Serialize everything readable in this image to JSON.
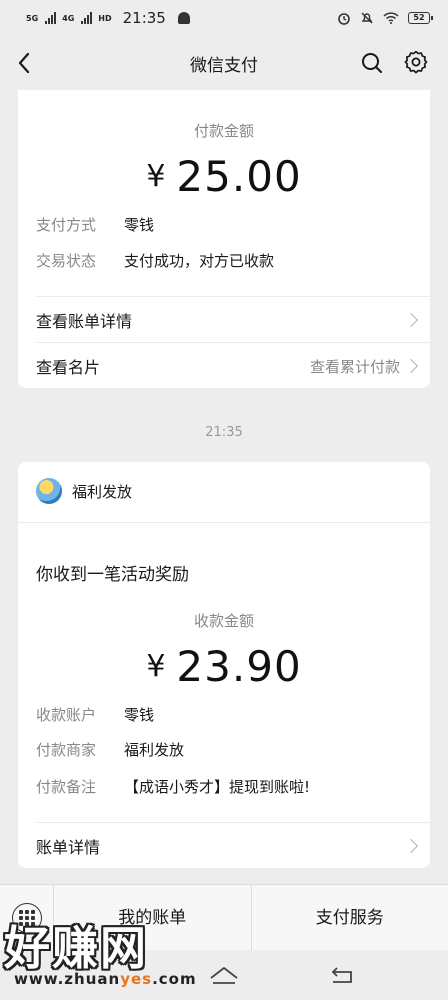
{
  "status_bar": {
    "sig1_label": "5G",
    "sig2_label": "4G",
    "hd_label": "HD",
    "time": "21:35",
    "battery": "52"
  },
  "nav": {
    "title": "微信支付"
  },
  "payment_card": {
    "amount_label": "付款金额",
    "currency": "¥",
    "amount": "25.00",
    "fields": [
      {
        "key": "支付方式",
        "value": "零钱"
      },
      {
        "key": "交易状态",
        "value": "支付成功，对方已收款"
      }
    ],
    "rows": {
      "bill_detail": "查看账单详情",
      "card": "查看名片",
      "card_right": "查看累计付款"
    }
  },
  "timestamp": "21:35",
  "reward_card": {
    "sender": "福利发放",
    "message_title": "你收到一笔活动奖励",
    "amount_label": "收款金额",
    "currency": "¥",
    "amount": "23.90",
    "fields": [
      {
        "key": "收款账户",
        "value": "零钱"
      },
      {
        "key": "付款商家",
        "value": "福利发放"
      },
      {
        "key": "付款备注",
        "value": "【成语小秀才】提现到账啦!"
      }
    ],
    "detail_row": "账单详情"
  },
  "bottom_bar": {
    "tab1": "我的账单",
    "tab2": "支付服务"
  },
  "watermark": {
    "big": "好赚网",
    "url_prefix": "www.zhuan",
    "url_highlight": "yes",
    "url_suffix": ".com"
  },
  "colors": {
    "background": "#ededed",
    "card": "#ffffff",
    "label_gray": "#888888",
    "text": "#191919",
    "watermark_orange": "#e8741f"
  }
}
